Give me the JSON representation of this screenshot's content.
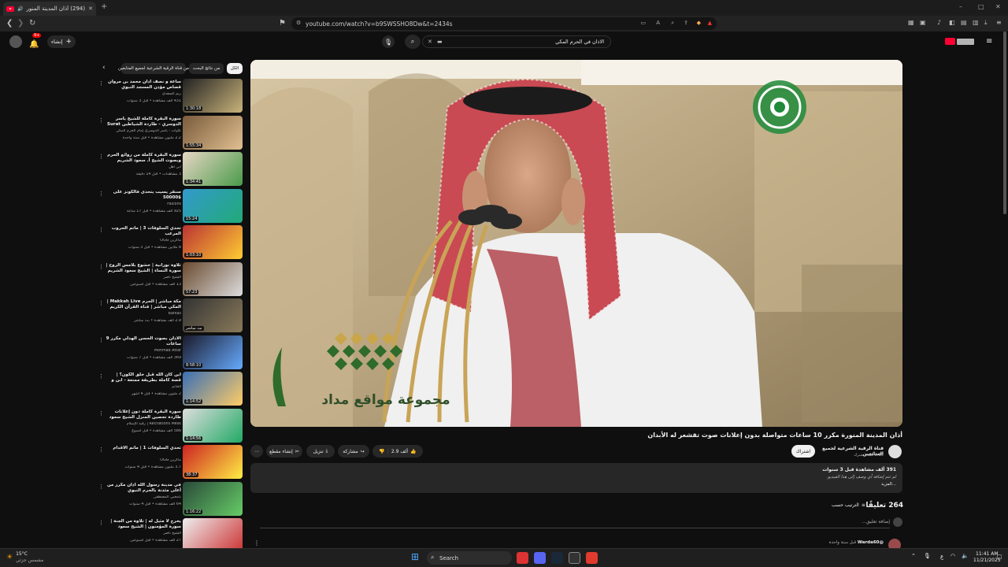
{
  "browser": {
    "tab_title": "(294) أذان المدينة المنورة مكرر",
    "url": "youtube.com/watch?v=b9SWSSHO8Dw&t=2434s",
    "window_controls": [
      "–",
      "□",
      "✕"
    ]
  },
  "youtube": {
    "search_query": "الاذان في الحرم المكي",
    "create_label": "إنشاء",
    "notification_count": "9+",
    "chips": [
      "الكل",
      "من نتائج البحث",
      "من قناة الرقية الشرعية لجميع المتابعين"
    ],
    "recommendations": [
      {
        "title": "ساعة و نصف أذان محمد بن مروان قصاص مؤذن المسجد النبوي الشريف",
        "channel": "ريم السعدي",
        "meta": "431 ألف مشاهدة • قبل 3 سنوات",
        "duration": "1:30:18"
      },
      {
        "title": "سورة البقرة كاملة للشيخ ياسر الدوسري - طاردة الشياطين Surat Al Baqarah",
        "channel": "تلاوات - ياسر الدوسري إمام الحرم المكي",
        "meta": "2.2 مليون مشاهدة • قبل سنة واحدة",
        "duration": "1:55:34"
      },
      {
        "title": "سورة البقرة كاملة من روائع الحرم وبصوت الشيخ أ. سعود الشريم Surat Al",
        "channel": "أبي أهل",
        "meta": "3 مشاهدات • قبل 14 دقيقة",
        "duration": "1:34:41"
      },
      {
        "title": "سنقر يسيب يتحدى فالكونز على $50000",
        "channel": "Falcons",
        "meta": "925 ألف مشاهدة • قبل 17 ساعة",
        "duration": "15:24"
      },
      {
        "title": "تحدي السلوفات 3 | ماتم الحروب المرعب",
        "channel": "ماكرين OGG",
        "meta": "8 ملايين مشاهدة • قبل 3 سنوات",
        "duration": "1:03:10"
      },
      {
        "title": "تلاوة نورانية | خشوع بلامس الروح | سورة النساء | الشيخ سعود الشريم saud",
        "channel": "الشيخ ناصر",
        "meta": "13 ألف مشاهدة • قبل أسبوعين",
        "duration": "57:23"
      },
      {
        "title": "مكة مباشر | الحرم Makkah Live | المكي مباشر | قناة القرآن الكريم السعودية",
        "channel": "Barkas",
        "meta": "2.9 ألف مشاهدة • بث مباشر",
        "duration": "بث مباشر"
      },
      {
        "title": "الاذان بصوت الحسن الهدلي مكرر 9 ساعات",
        "channel": "Mohmad Attar",
        "meta": "369 ألف مشاهدة • قبل 7 سنوات",
        "duration": "8:58:10"
      },
      {
        "title": "أين كان الله قبل خلق الكون؟ | قصة كاملة بطريقة ممتعة - ابن و خلق",
        "channel": "الخاتم",
        "meta": "2 مليون مشاهدة • قبل 4 أشهر",
        "duration": "1:14:52"
      },
      {
        "title": "سورة البقرة كاملة دون إعلانات طاردة تحصين المنزل الشيخ سعود الشريم surah",
        "channel": "Recitations Mesk | رقية الإسلام",
        "meta": "586 ألف مشاهدة • قبل أسبوع",
        "duration": "1:14:56"
      },
      {
        "title": "تحدي السلوفات 1 | ماتم الأقدام",
        "channel": "ماكرين OGG",
        "meta": "3.7 مليون مشاهدة • قبل 4 سنوات",
        "duration": "38:37"
      },
      {
        "title": "في مدينة رسول الله أذان مكرر من أعلى مئذنة بالحرم النبوي",
        "channel": "يامحبي المصطفى",
        "meta": "64 ألف مشاهدة • قبل 4 سنوات",
        "duration": "1:16:22"
      },
      {
        "title": "يخرج لا مثيل له | تلاوة من الجنة | سورة المؤمنون | الشيخ سعود الشريم saud",
        "channel": "الشيخ ناصر",
        "meta": "27 ألف مشاهدة • قبل أسبوعين",
        "duration": ""
      }
    ],
    "video": {
      "title": "أذان المدينة المنورة مكرر 10 ساعات متواصلة بدون إعلانات صوت تقشعر له الأبدان",
      "overlay_brand": "مجموعة مواقع مداد",
      "channel_name": "قناة الرقية الشرعية لجميع المتابعين",
      "subscribers": "2.85 ألف مشترك",
      "subscribe_label": "اشتراك",
      "likes": "2.9 ألف",
      "share_label": "مشاركة",
      "download_label": "تنزيل",
      "clip_label": "إنشاء مقطع",
      "views_line": "391 ألف مشاهدة  قبل 3 سنوات",
      "description": "لم تتم إضافة أي وصف إلى هذا الفيديو.",
      "more_label": "...المزيد"
    },
    "comments": {
      "count_label": "264 تعليقًا",
      "sort_label": "الترتيب حسب",
      "add_placeholder": "إضافة تعليق...",
      "first_author": "@Warda60",
      "first_time": "قبل سنة واحدة"
    }
  },
  "taskbar": {
    "search_label": "Search",
    "time": "11:41 AM",
    "date": "11/21/2025",
    "weather_temp": "15°C",
    "weather_desc": "مشمس جزئي",
    "lang": "ع"
  }
}
